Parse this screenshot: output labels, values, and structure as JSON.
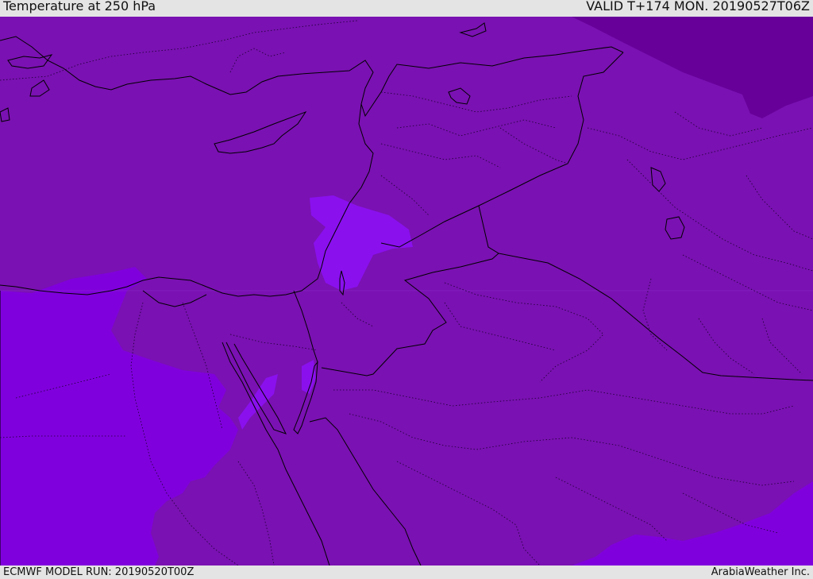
{
  "header": {
    "title": "Temperature at 250 hPa",
    "valid_time": "VALID T+174 MON. 20190527T06Z"
  },
  "footer": {
    "model_run": "ECMWF MODEL RUN: 20190520T00Z",
    "credit": "ArabiaWeather Inc."
  },
  "map": {
    "colors": {
      "base": "#7a11b2",
      "warm_band": "#8000dd",
      "warm_patch": "#8a10ee",
      "cold_region": "#660099",
      "coast_line": "#000000",
      "border_line": "#000000"
    }
  }
}
